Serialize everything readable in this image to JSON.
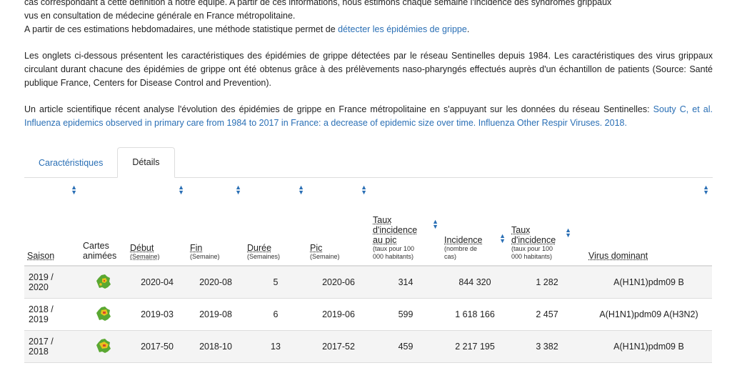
{
  "intro": {
    "line1": "cas correspondant à cette définition à notre équipe. A partir de ces informations, nous estimons chaque semaine l'incidence des syndromes grippaux",
    "line2": "vus en consultation de médecine générale en France métropolitaine.",
    "p2_text": "A partir de ces estimations hebdomadaires, une méthode statistique permet de ",
    "p2_link": "détecter les épidémies de grippe",
    "p2_end": ".",
    "p3": "Les onglets ci-dessous présentent les caractéristiques des épidémies de grippe détectées par le réseau Sentinelles depuis 1984. Les caractéristiques des virus grippaux circulant durant chacune des épidémies de grippe ont été obtenus grâce à des prélèvements naso-pharyngés effectués auprès d'un échantillon de patients (Source: Santé publique France, Centers for Disease Control and Prevention).",
    "p4_text": "Un article scientifique récent analyse l'évolution des épidémies de grippe en France métropolitaine en s'appuyant sur les données du réseau Sentinelles: ",
    "p4_link": "Souty C, et al. Influenza epidemics observed in primary care from 1984 to 2017 in France: a decrease of epidemic size over time. Influenza Other Respir Viruses. 2018."
  },
  "tabs": [
    {
      "label": "Caractéristiques",
      "active": false
    },
    {
      "label": "Détails",
      "active": true
    }
  ],
  "table": {
    "headers": {
      "saison": "Saison",
      "cartes_1": "Cartes",
      "cartes_2": "animées",
      "debut": "Début",
      "debut_unit": "(Semaine)",
      "fin": "Fin",
      "fin_unit": "(Semaine)",
      "duree": "Durée",
      "duree_unit": "(Semaines)",
      "pic": "Pic",
      "pic_unit": "(Semaine)",
      "taux_pic_1": "Taux",
      "taux_pic_2": "d'incidence",
      "taux_pic_3": "au pic",
      "taux_pic_unit": "(taux pour 100 000 habitants)",
      "incidence": "Incidence",
      "incidence_unit": "(nombre de cas)",
      "taux_1": "Taux",
      "taux_2": "d'incidence",
      "taux_unit": "(taux pour 100 000 habitants)",
      "virus": "Virus dominant"
    },
    "rows": [
      {
        "saison": "2019 / 2020",
        "debut": "2020-04",
        "fin": "2020-08",
        "duree": "5",
        "pic": "2020-06",
        "taux_pic": "314",
        "incidence": "844 320",
        "taux": "1 282",
        "virus": "A(H1N1)pdm09 B"
      },
      {
        "saison": "2018 / 2019",
        "debut": "2019-03",
        "fin": "2019-08",
        "duree": "6",
        "pic": "2019-06",
        "taux_pic": "599",
        "incidence": "1 618 166",
        "taux": "2 457",
        "virus": "A(H1N1)pdm09 A(H3N2)"
      },
      {
        "saison": "2017 / 2018",
        "debut": "2017-50",
        "fin": "2018-10",
        "duree": "13",
        "pic": "2017-52",
        "taux_pic": "459",
        "incidence": "2 217 195",
        "taux": "3 382",
        "virus": "A(H1N1)pdm09 B"
      }
    ]
  },
  "colors": {
    "link": "#2a6fb5",
    "map_green": "#5aa832",
    "map_yellow": "#e8c21c",
    "map_red": "#d9482b"
  },
  "icons": {
    "sort": "sort-icon",
    "map": "france-map-icon"
  }
}
